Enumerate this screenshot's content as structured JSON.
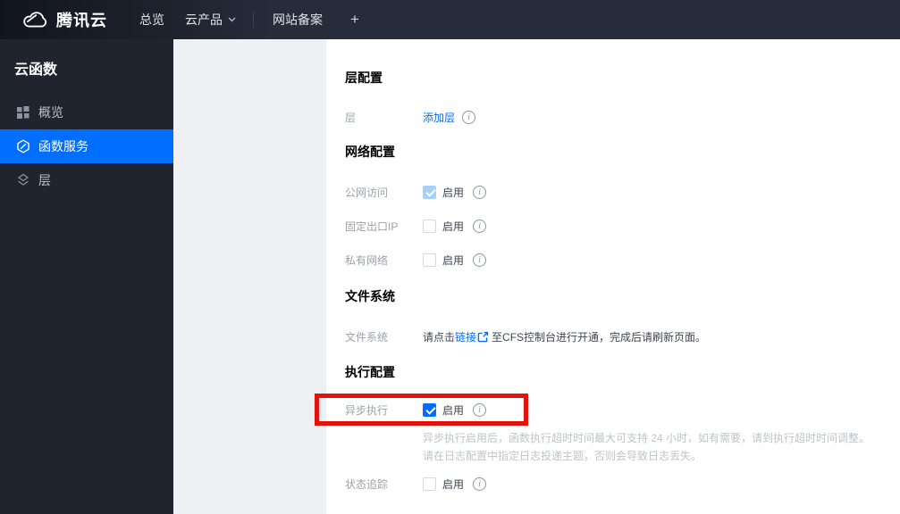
{
  "topbar": {
    "brand": "腾讯云",
    "nav": {
      "overview": "总览",
      "products": "云产品",
      "beian": "网站备案",
      "plus": "+"
    }
  },
  "sidebar": {
    "title": "云函数",
    "items": [
      {
        "label": "概览"
      },
      {
        "label": "函数服务"
      },
      {
        "label": "层"
      }
    ]
  },
  "content": {
    "layer_section": {
      "heading": "层配置",
      "row": {
        "label": "层",
        "add_link": "添加层"
      }
    },
    "network_section": {
      "heading": "网络配置",
      "rows": [
        {
          "label": "公网访问",
          "enable_label": "启用",
          "state": "checked-disabled"
        },
        {
          "label": "固定出口IP",
          "enable_label": "启用",
          "state": "unchecked"
        },
        {
          "label": "私有网络",
          "enable_label": "启用",
          "state": "unchecked"
        }
      ]
    },
    "filesystem_section": {
      "heading": "文件系统",
      "row": {
        "label": "文件系统",
        "text_before": "请点击",
        "link": "链接",
        "text_after": "至CFS控制台进行开通，完成后请刷新页面。"
      }
    },
    "execution_section": {
      "heading": "执行配置",
      "async_row": {
        "label": "异步执行",
        "enable_label": "启用",
        "state": "checked"
      },
      "async_description": [
        "异步执行启用后，函数执行超时时间最大可支持 24 小时，如有需要，请到执行超时时间调整。",
        "请在日志配置中指定日志投递主题，否则会导致日志丢失。"
      ],
      "trace_row": {
        "label": "状态追踪",
        "enable_label": "启用",
        "state": "unchecked"
      }
    }
  },
  "annotation": {
    "type": "highlight-box",
    "color": "#e3120b"
  },
  "colors": {
    "accent": "#006eff",
    "topbar_bg": "#262c39",
    "sidebar_bg": "#20242e",
    "gutter_bg": "#eef0f4",
    "panel_bg": "#ffffff",
    "label_gray": "#9da1a9",
    "desc_gray": "#c0c3c9",
    "link_blue": "#006eff",
    "disabled_check_bg": "#a6cff9",
    "highlight_red": "#e3120b"
  }
}
